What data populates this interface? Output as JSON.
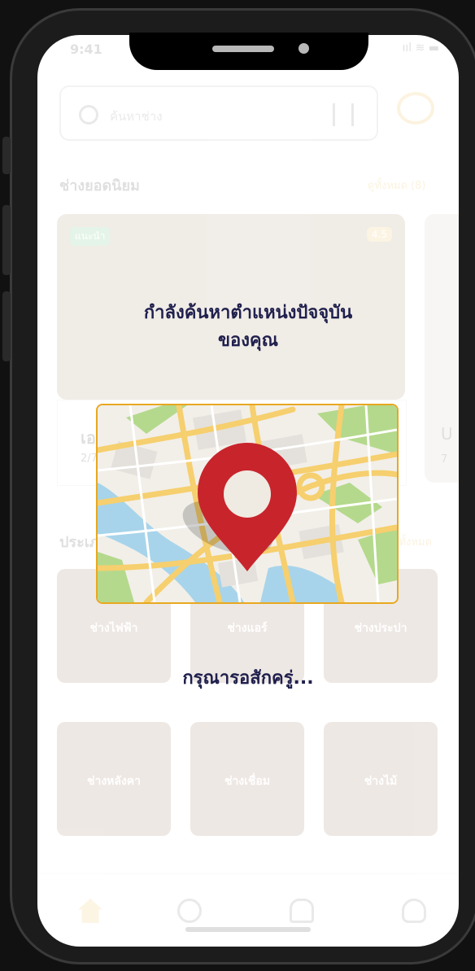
{
  "status_bar": {
    "time": "9:41",
    "icons": "ııl ≋ ▬"
  },
  "search": {
    "placeholder": "ค้นหาช่าง"
  },
  "popular": {
    "title": "ช่างยอดนิยม",
    "more": "ดูทั้งหมด (8)"
  },
  "featured_card": {
    "badge": "แนะนำ",
    "rating": "4.5",
    "name": "เอ",
    "sub": "2/7"
  },
  "featured_card_2": {
    "name": "U",
    "sub": "7"
  },
  "types": {
    "title": "ประเภทช่าง",
    "more": "ดูทั้งหมด"
  },
  "categories": [
    "ช่างไฟฟ้า",
    "ช่างแอร์",
    "ช่างประปา",
    "ช่างหลังคา",
    "ช่างเชื่อม",
    "ช่างไม้"
  ],
  "overlay": {
    "title_line1": "กำลังค้นหาตำแหน่งปัจจุบัน",
    "title_line2": "ของคุณ",
    "waiting": "กรุณารอสักครู่..."
  },
  "colors": {
    "accent": "#e8a820",
    "pin": "#c8242c",
    "title_text": "#1f1f4d"
  },
  "nav": [
    "home-icon",
    "chat-money-icon",
    "bell-icon",
    "profile-icon"
  ]
}
